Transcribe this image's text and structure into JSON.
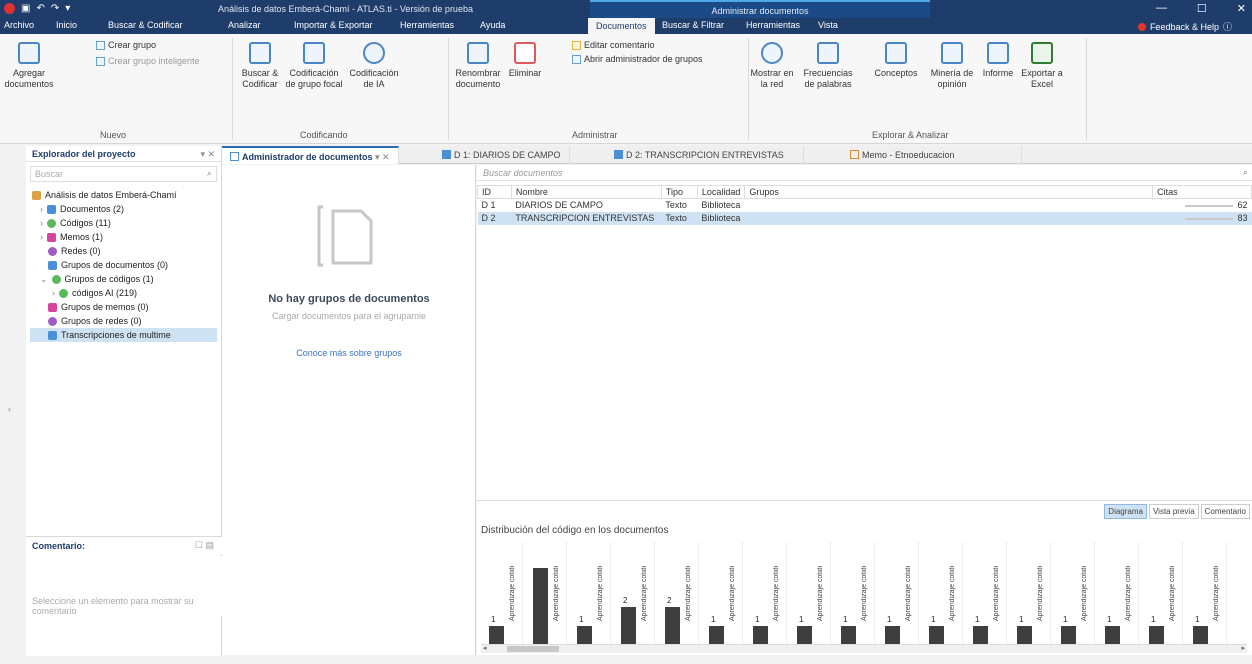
{
  "window": {
    "title": "Análisis de datos Emberá-Chamí - ATLAS.ti - Versión de prueba",
    "context_title": "Administrar documentos",
    "minimize": "—",
    "maximize": "☐",
    "close": "✕"
  },
  "menu": [
    {
      "label": "Archivo"
    },
    {
      "label": "Inicio"
    },
    {
      "label": "Buscar & Codificar"
    },
    {
      "label": "Analizar"
    },
    {
      "label": "Importar & Exportar"
    },
    {
      "label": "Herramientas"
    },
    {
      "label": "Ayuda"
    },
    {
      "label": "Documentos"
    },
    {
      "label": "Buscar & Filtrar"
    },
    {
      "label": "Herramientas"
    },
    {
      "label": "Vista"
    }
  ],
  "feedback": "Feedback & Help",
  "ribbon": {
    "add_documents": "Agregar documentos",
    "create_group": "Crear grupo",
    "create_smart_group": "Crear grupo inteligente",
    "group_new": "Nuevo",
    "search_code": "Buscar & Codificar",
    "focus_group_coding": "Codificación de grupo focal",
    "ai_coding": "Codificación de IA",
    "group_coding": "Codificando",
    "rename_doc": "Renombrar documento",
    "delete": "Eliminar",
    "edit_comment": "Editar comentario",
    "open_group_admin": "Abrir administrador de grupos",
    "group_admin": "Administrar",
    "show_network": "Mostrar en la red",
    "word_freq": "Frecuencias de palabras",
    "concepts": "Conceptos",
    "opinion_mining": "Minería de opinión",
    "report": "Informe",
    "export_excel": "Exportar a Excel",
    "group_explore": "Explorar & Analizar"
  },
  "project_explorer": {
    "title": "Explorador del proyecto",
    "search_placeholder": "Buscar",
    "items": [
      {
        "label": "Análisis de datos Emberá-Chamí",
        "color": "#d9a441"
      },
      {
        "label": "Documentos (2)",
        "color": "#4a90d9"
      },
      {
        "label": "Códigos (11)",
        "color": "#5cb85c"
      },
      {
        "label": "Memos (1)",
        "color": "#d6459b"
      },
      {
        "label": "Redes (0)",
        "color": "#a05cc6"
      },
      {
        "label": "Grupos de documentos (0)",
        "color": "#4a90d9"
      },
      {
        "label": "Grupos de códigos (1)",
        "color": "#5cb85c"
      },
      {
        "label": "códigos AI (219)",
        "color": "#5cb85c"
      },
      {
        "label": "Grupos de memos (0)",
        "color": "#d6459b"
      },
      {
        "label": "Grupos de redes (0)",
        "color": "#a05cc6"
      },
      {
        "label": "Transcripciones de multime",
        "color": "#4a90d9"
      }
    ]
  },
  "comment": {
    "title": "Comentario:",
    "placeholder": "Seleccione un elemento para mostrar su comentario"
  },
  "tabs": [
    {
      "label": "Administrador de documentos"
    },
    {
      "label": "D 1: DIARIOS DE CAMPO"
    },
    {
      "label": "D 2: TRANSCRIPCION ENTREVISTAS"
    },
    {
      "label": "Memo - Etnoeducacion"
    }
  ],
  "groups_pane": {
    "empty_title": "No hay grupos de documentos",
    "empty_sub": "Cargar documentos para el agrupamie",
    "link": "Conoce más sobre grupos"
  },
  "documents": {
    "search_placeholder": "Buscar documentos",
    "columns": [
      "ID",
      "Nombre",
      "Tipo",
      "Localidad",
      "Grupos",
      "Citas"
    ],
    "rows": [
      {
        "id": "D 1",
        "name": "DIARIOS DE CAMPO",
        "type": "Texto",
        "location": "Biblioteca",
        "groups": "",
        "quotes": "62"
      },
      {
        "id": "D 2",
        "name": "TRANSCRIPCION ENTREVISTAS",
        "type": "Texto",
        "location": "Biblioteca",
        "groups": "",
        "quotes": "83"
      }
    ]
  },
  "chart_view_tabs": [
    "Diagrama",
    "Vista previa",
    "Comentario"
  ],
  "chart_data": {
    "type": "bar",
    "title": "Distribución del código en los documentos",
    "categories": [
      "Aprendizaje cotidi",
      "Aprendizaje cotidi",
      "Aprendizaje cotidi",
      "Aprendizaje cotidi",
      "Aprendizaje cotidi",
      "Aprendizaje cotidi",
      "Aprendizaje cotidi",
      "Aprendizaje cotidi",
      "Aprendizaje cotidi",
      "Aprendizaje cotidi",
      "Aprendizaje cotidi",
      "Aprendizaje cotidi",
      "Aprendizaje cotidi",
      "Aprendizaje cotidi",
      "Aprendizaje cotidi",
      "Aprendizaje cotidi",
      "Aprendizaje cotidi"
    ],
    "values": [
      1,
      4,
      1,
      2,
      2,
      1,
      1,
      1,
      1,
      1,
      1,
      1,
      1,
      1,
      1,
      1,
      1
    ],
    "labels": [
      "1",
      "",
      "1",
      "2",
      "2",
      "1",
      "1",
      "1",
      "1",
      "1",
      "1",
      "1",
      "1",
      "1",
      "1",
      "1",
      "1"
    ],
    "ylim": [
      0,
      4
    ]
  }
}
